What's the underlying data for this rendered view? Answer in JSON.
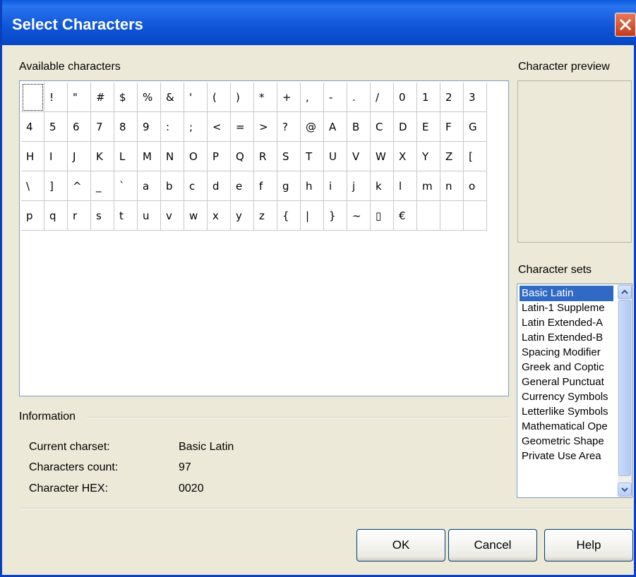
{
  "window": {
    "title": "Select Characters"
  },
  "labels": {
    "available": "Available characters",
    "preview": "Character preview",
    "charsets": "Character sets",
    "information": "Information"
  },
  "characters": [
    " ",
    "!",
    "\"",
    "#",
    "$",
    "%",
    "&",
    "'",
    "(",
    ")",
    "*",
    "+",
    ",",
    "-",
    ".",
    "/",
    "0",
    "1",
    "2",
    "3",
    "4",
    "5",
    "6",
    "7",
    "8",
    "9",
    ":",
    ";",
    "<",
    "=",
    ">",
    "?",
    "@",
    "A",
    "B",
    "C",
    "D",
    "E",
    "F",
    "G",
    "H",
    "I",
    "J",
    "K",
    "L",
    "M",
    "N",
    "O",
    "P",
    "Q",
    "R",
    "S",
    "T",
    "U",
    "V",
    "W",
    "X",
    "Y",
    "Z",
    "[",
    "\\",
    "]",
    "^",
    "_",
    "`",
    "a",
    "b",
    "c",
    "d",
    "e",
    "f",
    "g",
    "h",
    "i",
    "j",
    "k",
    "l",
    "m",
    "n",
    "o",
    "p",
    "q",
    "r",
    "s",
    "t",
    "u",
    "v",
    "w",
    "x",
    "y",
    "z",
    "{",
    "|",
    "}",
    "~",
    "▯",
    "€"
  ],
  "charsets": [
    "Basic Latin",
    "Latin-1 Suppleme",
    "Latin Extended-A",
    "Latin Extended-B",
    "Spacing Modifier",
    "Greek and Coptic",
    "General Punctuat",
    "Currency Symbols",
    "Letterlike Symbols",
    "Mathematical Ope",
    "Geometric Shape",
    "Private Use Area"
  ],
  "info": {
    "charset_label": "Current charset:",
    "charset_value": "Basic Latin",
    "count_label": "Characters count:",
    "count_value": "97",
    "hex_label": "Character HEX:",
    "hex_value": "0020"
  },
  "buttons": {
    "ok": "OK",
    "cancel": "Cancel",
    "help": "Help"
  },
  "colors": {
    "titlebar": "#0a54d9",
    "selection": "#316ac5",
    "close": "#d9582f"
  }
}
